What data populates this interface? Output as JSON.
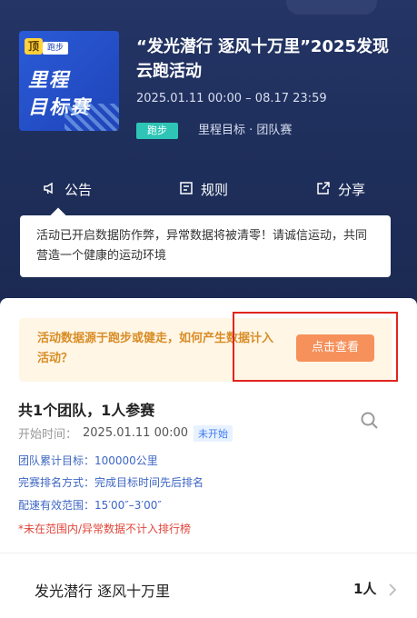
{
  "event": {
    "cover_badge_top": "顶",
    "cover_badge_run": "跑步",
    "cover_line1": "里程",
    "cover_line2": "目标赛",
    "title": "“发光潜行 逐风十万里”2025发现云跑活动",
    "date_range": "2025.01.11 00:00 – 08.17 23:59",
    "sport_tag": "跑步",
    "type_text": "里程目标 · 团队赛"
  },
  "actions": {
    "notice_label": "公告",
    "rules_label": "规则",
    "share_label": "分享"
  },
  "notice": {
    "text": "活动已开启数据防作弊，异常数据将被清零！请诚信运动，共同营造一个健康的运动环境"
  },
  "tip": {
    "text": "活动数据源于跑步或健走，如何产生数据计入活动？",
    "button_label": "点击查看"
  },
  "summary": {
    "teams_text": "共1个团队，1人参赛",
    "start_label": "开始时间：",
    "start_value": "2025.01.11 00:00",
    "status": "未开始",
    "target": "团队累计目标：100000公里",
    "ranking": "完赛排名方式：完成目标时间先后排名",
    "pace": "配速有效范围：15′00″–3′00″",
    "warning": "*未在范围内/异常数据不计入排行榜"
  },
  "team_row": {
    "name": "发光潜行 逐风十万里",
    "count": "1人"
  },
  "colors": {
    "header_bg": "#243566",
    "accent_orange": "#f6915b",
    "tag_teal": "#2ec5b6",
    "info_blue": "#3d66c4",
    "warning_red": "#e0453a",
    "highlight_red": "#e0241f"
  }
}
